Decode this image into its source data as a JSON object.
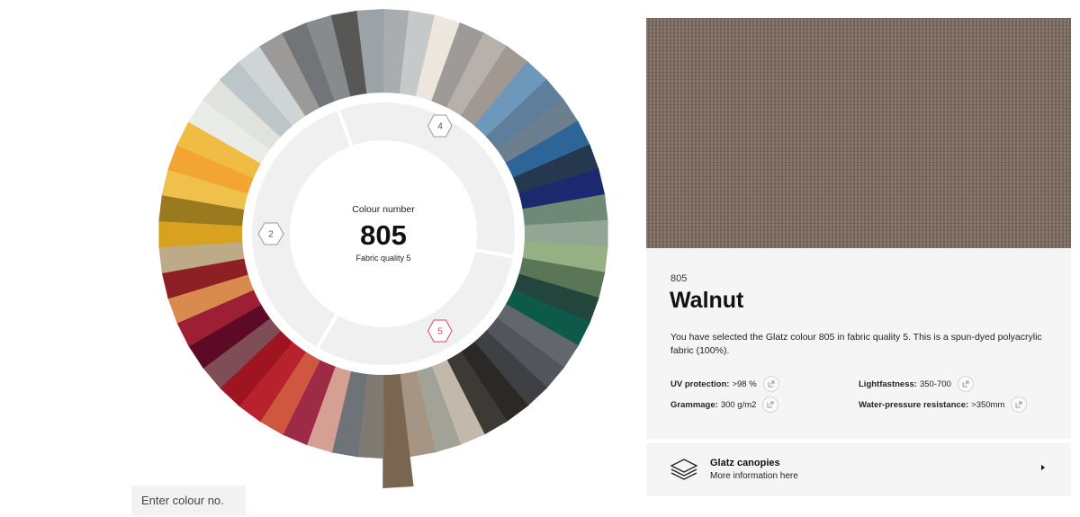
{
  "wheel": {
    "center_caption": "Colour number",
    "center_number": "805",
    "center_quality": "Fabric quality 5",
    "quality_badges": {
      "q4": "4",
      "q2": "2",
      "q5": "5"
    },
    "selected_colour": "#7a6550",
    "segments": [
      "#a9adaf",
      "#c6c9ca",
      "#ece6dc",
      "#9d9a97",
      "#b8b1ab",
      "#a19892",
      "#6e97bc",
      "#5e7e9b",
      "#6c7f8f",
      "#2e6599",
      "#25384f",
      "#1b2a6e",
      "#6e8a76",
      "#93a695",
      "#95b083",
      "#5a7656",
      "#22463c",
      "#0e5a4a",
      "#62676e",
      "#52555b",
      "#3f4044",
      "#2b2825",
      "#3d3a35",
      "#c2b8ab",
      "#a3a296",
      "#a59582",
      "#7a6550",
      "#7f7a72",
      "#6d7377",
      "#d5a093",
      "#9d2b45",
      "#cf5740",
      "#b8222d",
      "#9f1421",
      "#7e4d55",
      "#5c0a26",
      "#9d1f33",
      "#d98a4f",
      "#8e1f24",
      "#bdab88",
      "#d9a120",
      "#9a7a1e",
      "#f0c14a",
      "#f3a533",
      "#f0bc44",
      "#eaece8",
      "#e0e2dd",
      "#bcc5c7",
      "#cfd4d6",
      "#9b9a98",
      "#727577",
      "#888b8d",
      "#575756",
      "#9ca3a7"
    ]
  },
  "search": {
    "placeholder": "Enter colour no."
  },
  "detail": {
    "number": "805",
    "name": "Walnut",
    "description": "You have selected the Glatz colour 805 in fabric quality 5. This is a spun-dyed polyacrylic fabric (100%).",
    "uv_label": "UV protection:",
    "uv_value": ">98 %",
    "light_label": "Lightfastness:",
    "light_value": "350-700",
    "gram_label": "Grammage:",
    "gram_value": "300 g/m2",
    "water_label": "Water-pressure resistance:",
    "water_value": ">350mm"
  },
  "canopy": {
    "title": "Glatz canopies",
    "subtitle": "More information here"
  },
  "colors": {
    "accent_pink": "#e0426a",
    "panel_bg": "#f5f5f5"
  }
}
